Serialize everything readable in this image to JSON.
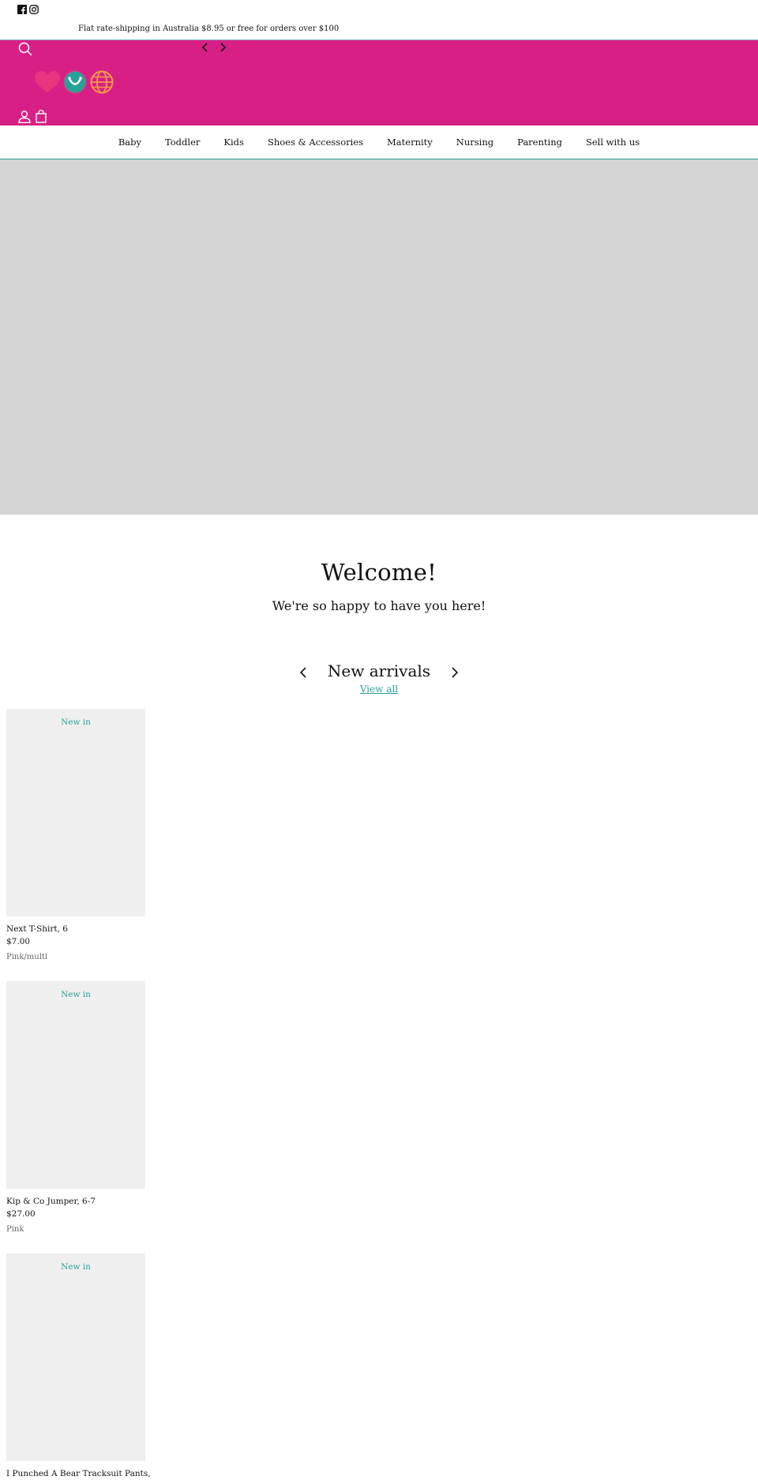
{
  "topbar": {
    "social_icons": [
      "facebook-icon",
      "instagram-icon"
    ],
    "announcement": "Flat rate-shipping in Australia $8.95 or free for orders over $100"
  },
  "header": {
    "background_color": "#d81f85",
    "icons": [
      "search-icon",
      "chevron-left-icon",
      "chevron-right-icon",
      "heart-icon",
      "smile-icon",
      "globe-icon",
      "account-icon",
      "bag-icon"
    ]
  },
  "nav": {
    "items": [
      {
        "label": "Baby"
      },
      {
        "label": "Toddler"
      },
      {
        "label": "Kids"
      },
      {
        "label": "Shoes & Accessories"
      },
      {
        "label": "Maternity"
      },
      {
        "label": "Nursing"
      },
      {
        "label": "Parenting"
      },
      {
        "label": "Sell with us"
      }
    ]
  },
  "welcome": {
    "title": "Welcome!",
    "subtitle": "We're so happy to have you here!"
  },
  "new_arrivals": {
    "title": "New arrivals",
    "view_all": "View all",
    "products": [
      {
        "badge": "New in",
        "title": "Next T-Shirt, 6",
        "price": "$7.00",
        "variant": "Pink/multi"
      },
      {
        "badge": "New in",
        "title": "Kip & Co Jumper, 6-7",
        "price": "$27.00",
        "variant": "Pink"
      },
      {
        "badge": "New in",
        "title": "I Punched A Bear Tracksuit Pants,",
        "price": "",
        "variant": ""
      }
    ]
  },
  "colors": {
    "accent": "#2aa198",
    "brand_pink": "#d81f85",
    "hero_placeholder": "#d5d5d5",
    "product_placeholder": "#efefef"
  }
}
